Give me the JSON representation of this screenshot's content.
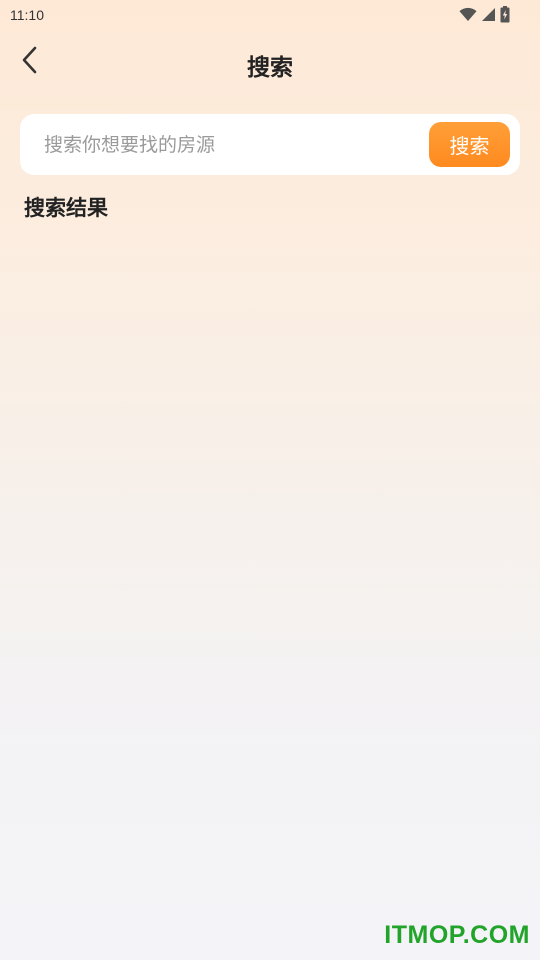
{
  "status_bar": {
    "time": "11:10",
    "icons": [
      "wifi-icon",
      "signal-icon",
      "battery-charging-icon"
    ]
  },
  "nav": {
    "back_icon": "chevron-left-icon",
    "title": "搜索"
  },
  "search": {
    "placeholder": "搜索你想要找的房源",
    "value": "",
    "button_label": "搜索",
    "button_color": "#ff9a2e"
  },
  "results": {
    "heading": "搜索结果",
    "items": []
  },
  "watermark": {
    "text": "ITMOP.COM",
    "color": "#22a32a"
  },
  "colors": {
    "background_top": "#fee9d6",
    "background_bottom": "#f4f4f8",
    "accent": "#ff9a2e"
  }
}
